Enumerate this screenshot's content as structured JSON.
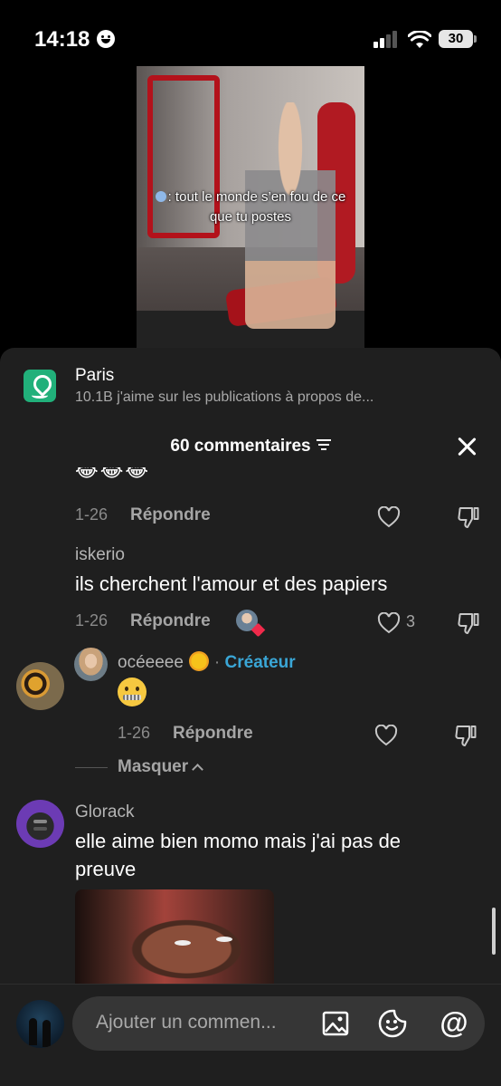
{
  "status_bar": {
    "time": "14:18",
    "battery": "30",
    "icons": [
      "face-emoji-icon",
      "signal-icon",
      "wifi-icon",
      "battery-icon"
    ]
  },
  "video": {
    "caption": ": tout le monde s’en fou de ce que tu postes"
  },
  "place_banner": {
    "title": "Paris",
    "subtitle": "10.1B j'aime sur les publications à propos de..."
  },
  "header": {
    "comment_count": "60 commentaires"
  },
  "comments": {
    "previous": {
      "emojis": "😂😂😂",
      "date": "1-26",
      "reply_label": "Répondre"
    },
    "c1": {
      "username": "iskerio",
      "text": "ils cherchent l'amour et des papiers",
      "date": "1-26",
      "reply_label": "Répondre",
      "likes": "3"
    },
    "r1": {
      "username": "océeeee",
      "dot": "·",
      "badge": "Créateur",
      "date": "1-26",
      "reply_label": "Répondre"
    },
    "hide_label": "Masquer",
    "c2": {
      "username": "Glorack",
      "text": "elle aime bien momo mais j'ai pas de preuve"
    }
  },
  "input": {
    "placeholder": "Ajouter un commen..."
  },
  "colors": {
    "sheet_bg": "#1f1f1f",
    "creator_badge": "#3aa6d6",
    "place_icon": "#21b07a",
    "heart_badge": "#f02a4b"
  }
}
